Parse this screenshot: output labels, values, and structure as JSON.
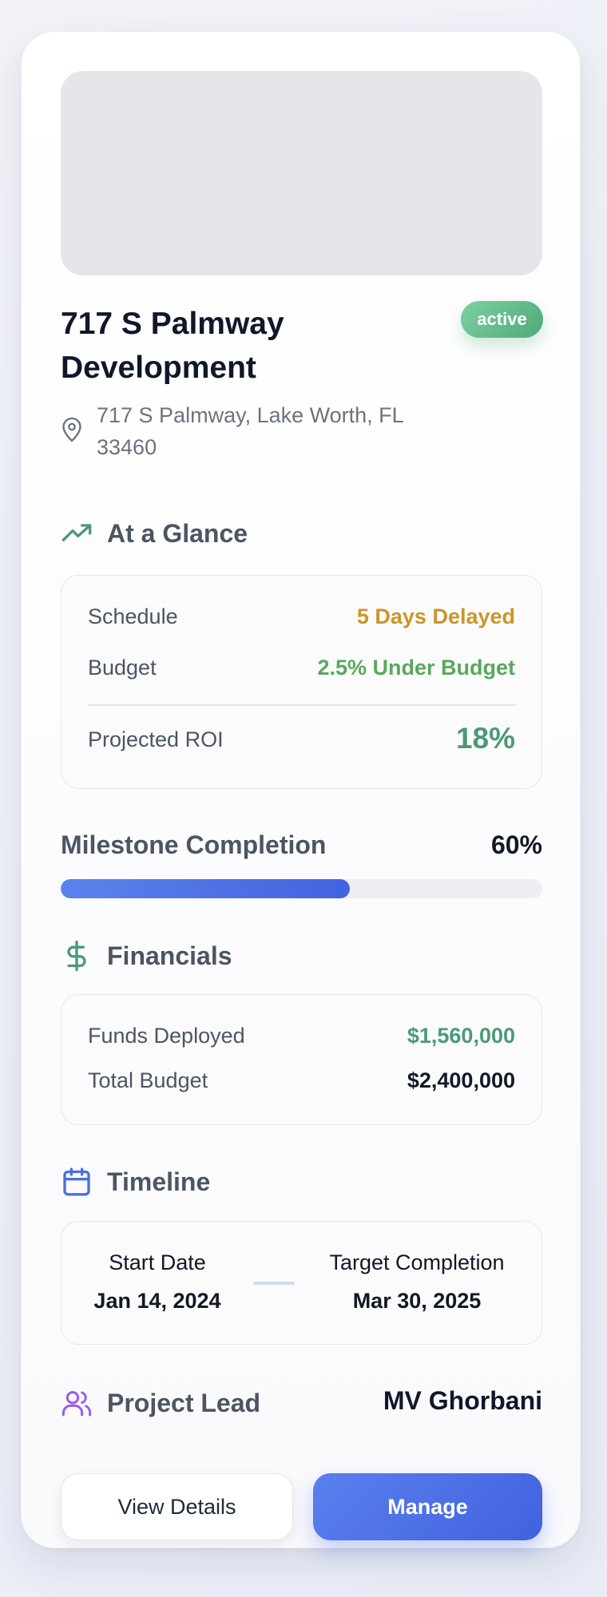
{
  "project": {
    "title": "717 S Palmway Development",
    "status": "active",
    "address": "717 S Palmway, Lake Worth, FL 33460"
  },
  "glance": {
    "heading": "At a Glance",
    "icon": "trending-up-icon",
    "schedule_label": "Schedule",
    "schedule_value": "5 Days Delayed",
    "budget_label": "Budget",
    "budget_value": "2.5% Under Budget",
    "roi_label": "Projected ROI",
    "roi_value": "18%"
  },
  "milestone": {
    "label": "Milestone Completion",
    "value_text": "60%",
    "fraction": 0.6
  },
  "financials": {
    "heading": "Financials",
    "icon": "dollar-icon",
    "funds_label": "Funds Deployed",
    "funds_value": "$1,560,000",
    "total_label": "Total Budget",
    "total_value": "$2,400,000"
  },
  "timeline": {
    "heading": "Timeline",
    "icon": "calendar-icon",
    "start_label": "Start Date",
    "start_date": "Jan 14, 2024",
    "target_label": "Target Completion",
    "target_date": "Mar 30, 2025"
  },
  "lead": {
    "heading": "Project Lead",
    "icon": "users-icon",
    "name": "MV Ghorbani"
  },
  "actions": {
    "view_details": "View Details",
    "manage": "Manage"
  },
  "colors": {
    "accent": "#4263e0",
    "success": "#4fa97a",
    "warning": "#c9962a",
    "budget_green": "#5aa85c",
    "lead_purple": "#9b5de5"
  }
}
